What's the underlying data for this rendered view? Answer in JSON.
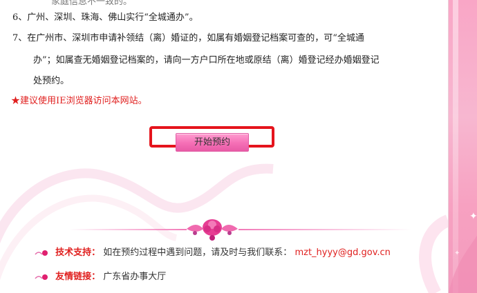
{
  "rules": {
    "cut_line": "家庭信息不一致的。",
    "item6": "6、广州、深圳、珠海、佛山实行“全城通办”。",
    "item7_line1": "7、在广州市、深圳市申请补领结（离）婚证的，如属有婚姻登记档案可查的，可“全城通",
    "item7_line2": "办”；如属查无婚姻登记档案的，请向一方户口所在地或原结（离）婚登记经办婚姻登记",
    "item7_line3": "处预约。"
  },
  "note": {
    "star": "★",
    "text": "建议使用IE浏览器访问本网站。"
  },
  "cta": {
    "label": "开始预约"
  },
  "footer": {
    "support_label": "技术支持：",
    "support_text": "如在预约过程中遇到问题，请及时与我们联系：",
    "support_email": "mzt_hyyy@gd.gov.cn",
    "links_label": "友情链接：",
    "links_text": "广东省办事大厅"
  },
  "colors": {
    "accent_red": "#e0201f",
    "pink": "#f56fb6",
    "frame_red": "#e5141c"
  },
  "icons": [
    "rose-bullet-icon",
    "flower-ornament-icon"
  ]
}
